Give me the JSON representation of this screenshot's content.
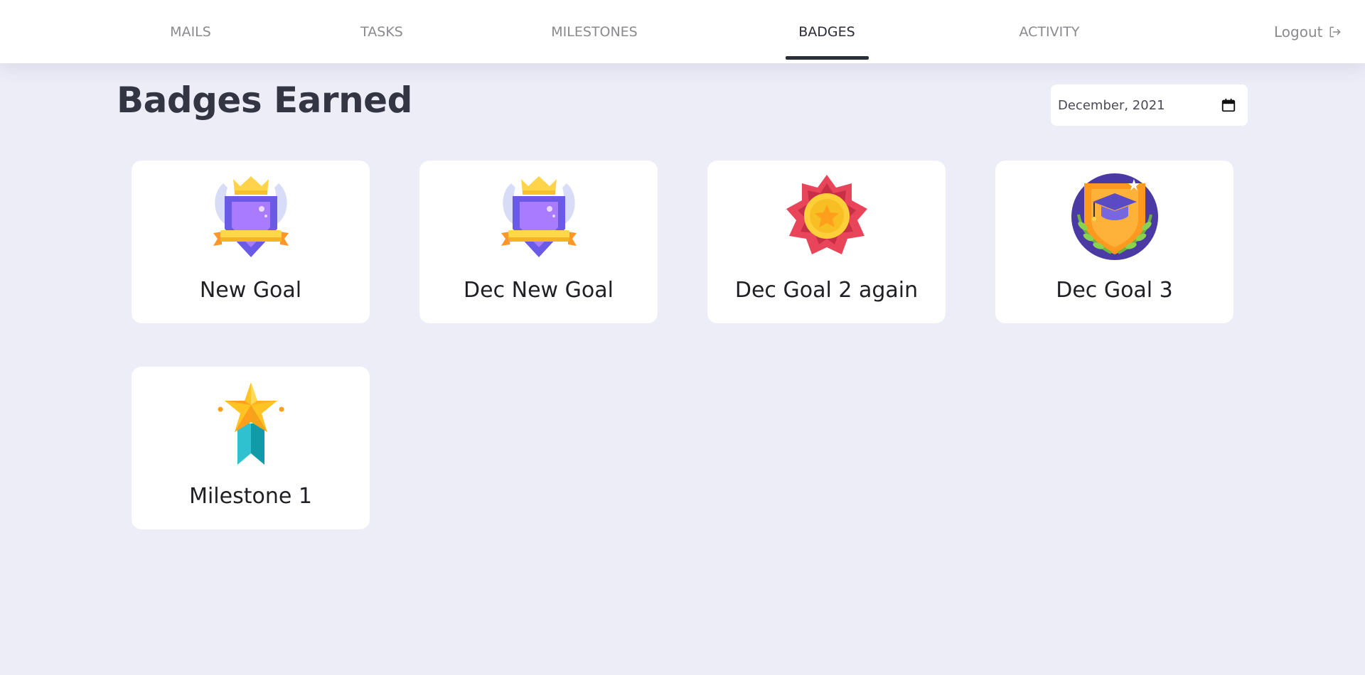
{
  "nav": {
    "items": [
      {
        "label": "MAILS"
      },
      {
        "label": "TASKS"
      },
      {
        "label": "MILESTONES"
      },
      {
        "label": "BADGES",
        "active": true
      },
      {
        "label": "ACTIVITY"
      }
    ],
    "logout_label": "Logout",
    "logout_icon": "logout-icon"
  },
  "page": {
    "title": "Badges Earned"
  },
  "month_picker": {
    "value": "December, 2021",
    "icon": "calendar-icon"
  },
  "badges": [
    {
      "name": "New Goal",
      "icon": "winged-crown-shield-badge-icon"
    },
    {
      "name": "Dec New Goal",
      "icon": "winged-crown-shield-badge-icon"
    },
    {
      "name": "Dec Goal 2 again",
      "icon": "star-rosette-badge-icon"
    },
    {
      "name": "Dec Goal 3",
      "icon": "graduation-shield-badge-icon"
    },
    {
      "name": "Milestone 1",
      "icon": "star-ribbon-badge-icon"
    }
  ],
  "colors": {
    "background": "#ededf8",
    "card": "#ffffff",
    "active_underline": "#2b2f3a",
    "nav_text": "#8a8a8f"
  }
}
